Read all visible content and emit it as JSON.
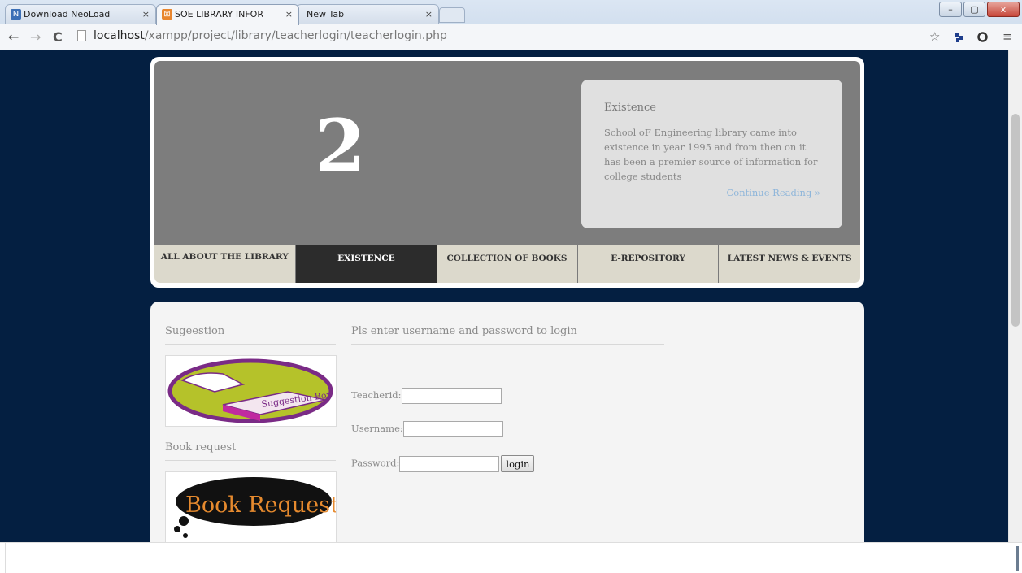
{
  "browser": {
    "tabs": [
      {
        "title": "Download NeoLoad softw",
        "close": "×"
      },
      {
        "title": "SOE LIBRARY INFORMATI",
        "close": "×"
      },
      {
        "title": "New Tab",
        "close": "×"
      }
    ],
    "window_controls": {
      "minimize": "–",
      "maximize": "▢",
      "close": "x"
    },
    "nav": {
      "back": "←",
      "forward": "→",
      "reload": "C"
    },
    "url_host": "localhost",
    "url_path": "/xampp/project/library/teacherlogin/teacherlogin.php",
    "toolbar_icons": {
      "star": "☆",
      "menu": "≡"
    }
  },
  "banner": {
    "number": "2",
    "info_title": "Existence",
    "info_text": "School oF Engineering library came into existence in year 1995 and from then on it has been a premier source of information for college students",
    "info_link": "Continue Reading »"
  },
  "nav": {
    "items": [
      "ALL ABOUT THE LIBRARY",
      "EXISTENCE",
      "COLLECTION OF BOOKS",
      "E-REPOSITORY",
      "LATEST NEWS & EVENTS"
    ],
    "active_index": 1
  },
  "sidebar": {
    "suggestion_title": "Sugeestion",
    "suggestion_image_text": "Suggestion Box",
    "book_request_title": "Book request",
    "book_request_image_text": "Book Request"
  },
  "login": {
    "title": "Pls enter username and password to login",
    "teacherid_label": "Teacherid:",
    "username_label": "Username:",
    "password_label": "Password:",
    "button_label": "login"
  },
  "colors": {
    "page_background": "#041f41",
    "banner_gray": "#7d7d7d",
    "nav_background": "#dcd9cc",
    "nav_active": "#2c2c2c",
    "link_blue": "#8fb6da"
  }
}
